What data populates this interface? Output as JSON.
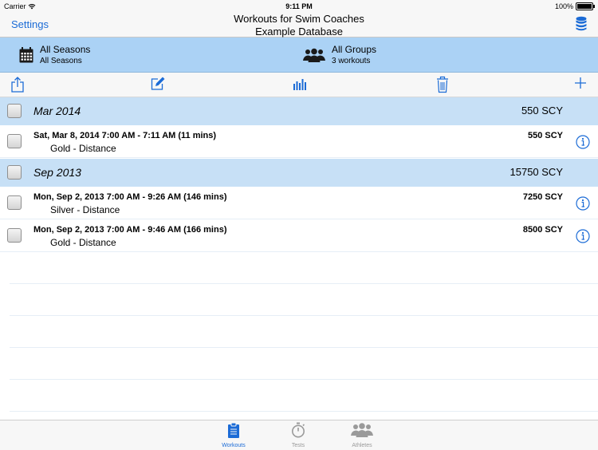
{
  "status": {
    "carrier": "Carrier",
    "time": "9:11 PM",
    "battery": "100%"
  },
  "nav": {
    "settings": "Settings",
    "title_line1": "Workouts for Swim Coaches",
    "title_line2": "Example Database"
  },
  "filters": {
    "season": {
      "main": "All Seasons",
      "sub": "All Seasons"
    },
    "group": {
      "main": "All Groups",
      "sub": "3 workouts"
    }
  },
  "sections": [
    {
      "label": "Mar 2014",
      "total": "550 SCY",
      "rows": [
        {
          "time": "Sat, Mar 8, 2014 7:00 AM - 7:11 AM (11 mins)",
          "group": "Gold - Distance",
          "distance": "550 SCY"
        }
      ]
    },
    {
      "label": "Sep 2013",
      "total": "15750 SCY",
      "rows": [
        {
          "time": "Mon, Sep 2, 2013 7:00 AM - 9:26 AM (146 mins)",
          "group": "Silver - Distance",
          "distance": "7250 SCY"
        },
        {
          "time": "Mon, Sep 2, 2013 7:00 AM - 9:46 AM (166 mins)",
          "group": "Gold - Distance",
          "distance": "8500 SCY"
        }
      ]
    }
  ],
  "tabs": [
    {
      "label": "Workouts",
      "icon": "clipboard-icon",
      "active": true
    },
    {
      "label": "Tests",
      "icon": "stopwatch-icon",
      "active": false
    },
    {
      "label": "Athletes",
      "icon": "athletes-icon",
      "active": false
    }
  ],
  "colors": {
    "accent": "#1b6bd6",
    "filter_bar": "#abd2f5",
    "section": "#c7e0f6",
    "inactive_tab": "#9a9a9a"
  }
}
